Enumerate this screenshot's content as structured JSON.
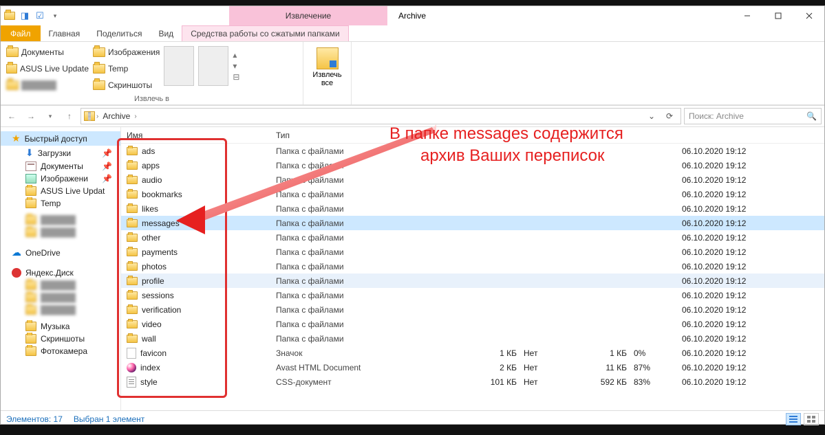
{
  "title_context_tab": "Извлечение",
  "window_title": "Archive",
  "tabs": {
    "file": "Файл",
    "home": "Главная",
    "share": "Поделиться",
    "view": "Вид",
    "context": "Средства работы со сжатыми папками"
  },
  "ribbon": {
    "destinations_col1": [
      "Документы",
      "ASUS Live Update",
      ""
    ],
    "destinations_col2": [
      "Изображения",
      "Temp",
      "Скриншоты"
    ],
    "group_extract_to": "Извлечь в",
    "extract_all": "Извлечь\nвсе"
  },
  "breadcrumb": [
    "Archive"
  ],
  "search_placeholder": "Поиск: Archive",
  "navpane": {
    "quick_access": "Быстрый доступ",
    "items_quick": [
      {
        "label": "Загрузки",
        "icon": "down",
        "pin": true
      },
      {
        "label": "Документы",
        "icon": "doc",
        "pin": true
      },
      {
        "label": "Изображени",
        "icon": "img",
        "pin": true
      },
      {
        "label": "ASUS Live Updat",
        "icon": "fld",
        "pin": false
      },
      {
        "label": "Temp",
        "icon": "fld",
        "pin": false
      }
    ],
    "blurred_block": true,
    "onedrive": "OneDrive",
    "yadisk": "Яндекс.Диск",
    "bottom_items": [
      "Музыка",
      "Скриншоты",
      "Фотокамера"
    ]
  },
  "columns": {
    "name": "Имя",
    "type": "Тип",
    "size": "",
    "szip": "",
    "ratio": "",
    "prot": "",
    "date": ""
  },
  "files": [
    {
      "name": "ads",
      "type": "Папка с файлами",
      "date": "06.10.2020 19:12",
      "kind": "folder"
    },
    {
      "name": "apps",
      "type": "Папка с файлами",
      "date": "06.10.2020 19:12",
      "kind": "folder"
    },
    {
      "name": "audio",
      "type": "Папка с файлами",
      "date": "06.10.2020 19:12",
      "kind": "folder"
    },
    {
      "name": "bookmarks",
      "type": "Папка с файлами",
      "date": "06.10.2020 19:12",
      "kind": "folder"
    },
    {
      "name": "likes",
      "type": "Папка с файлами",
      "date": "06.10.2020 19:12",
      "kind": "folder"
    },
    {
      "name": "messages",
      "type": "Папка с файлами",
      "date": "06.10.2020 19:12",
      "kind": "folder",
      "selected": true
    },
    {
      "name": "other",
      "type": "Папка с файлами",
      "date": "06.10.2020 19:12",
      "kind": "folder"
    },
    {
      "name": "payments",
      "type": "Папка с файлами",
      "date": "06.10.2020 19:12",
      "kind": "folder"
    },
    {
      "name": "photos",
      "type": "Папка с файлами",
      "date": "06.10.2020 19:12",
      "kind": "folder"
    },
    {
      "name": "profile",
      "type": "Папка с файлами",
      "date": "06.10.2020 19:12",
      "kind": "folder",
      "highlight": true
    },
    {
      "name": "sessions",
      "type": "Папка с файлами",
      "date": "06.10.2020 19:12",
      "kind": "folder"
    },
    {
      "name": "verification",
      "type": "Папка с файлами",
      "date": "06.10.2020 19:12",
      "kind": "folder"
    },
    {
      "name": "video",
      "type": "Папка с файлами",
      "date": "06.10.2020 19:12",
      "kind": "folder"
    },
    {
      "name": "wall",
      "type": "Папка с файлами",
      "date": "06.10.2020 19:12",
      "kind": "folder"
    },
    {
      "name": "favicon",
      "type": "Значок",
      "size": "1 КБ",
      "prot": "Нет",
      "szip": "1 КБ",
      "ratio": "0%",
      "date": "06.10.2020 19:12",
      "kind": "file"
    },
    {
      "name": "index",
      "type": "Avast HTML Document",
      "size": "2 КБ",
      "prot": "Нет",
      "szip": "11 КБ",
      "ratio": "87%",
      "date": "06.10.2020 19:12",
      "kind": "index"
    },
    {
      "name": "style",
      "type": "CSS-документ",
      "size": "101 КБ",
      "prot": "Нет",
      "szip": "592 КБ",
      "ratio": "83%",
      "date": "06.10.2020 19:12",
      "kind": "css"
    }
  ],
  "status": {
    "count": "Элементов: 17",
    "selection": "Выбран 1 элемент"
  },
  "annotation": {
    "line1": "В папке messages содержится",
    "line2": "архив Ваших переписок"
  }
}
